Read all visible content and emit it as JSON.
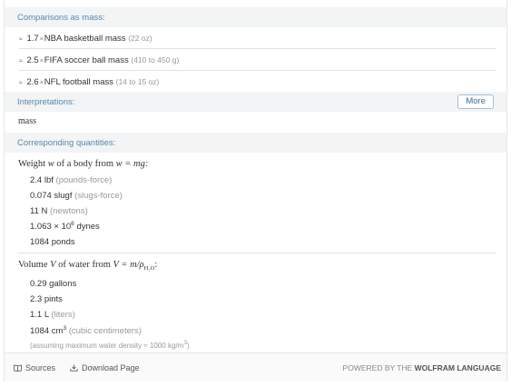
{
  "comparisons": {
    "title": "Comparisons as mass:",
    "rows": [
      {
        "approx": "≈",
        "factor": "1.7",
        "times": "×",
        "object": "NBA basketball mass",
        "range": "(22 oz)"
      },
      {
        "approx": "≈",
        "factor": "2.5",
        "times": "×",
        "object": "FIFA soccer ball mass",
        "range": "(410 to 450 g)"
      },
      {
        "approx": "≈",
        "factor": "2.6",
        "times": "×",
        "object": "NFL football mass",
        "range": "(14 to 15 oz)"
      }
    ]
  },
  "interpretations": {
    "title": "Interpretations:",
    "more_label": "More",
    "value": "mass"
  },
  "corresponding": {
    "title": "Corresponding quantities:",
    "weight": {
      "heading_prefix": "Weight",
      "heading_var": "w",
      "heading_mid": "of a body from",
      "heading_formula": "w = mg:",
      "lines": [
        {
          "value": "2.4 lbf",
          "desc": "(pounds-force)"
        },
        {
          "value": "0.074 slugf",
          "desc": "(slugs-force)"
        },
        {
          "value": "11 N",
          "desc": "(newtons)"
        },
        {
          "value": "1.063 × 10",
          "exp": "6",
          "suffix": "dynes"
        },
        {
          "value": "1084 ponds",
          "desc": ""
        }
      ]
    },
    "volume": {
      "heading_prefix": "Volume",
      "heading_var": "V",
      "heading_mid": "of water from",
      "heading_formula": "V = m/ρ",
      "heading_sub": "H₂O",
      "heading_end": ":",
      "lines": [
        {
          "value": "0.29 gallons",
          "desc": ""
        },
        {
          "value": "2.3 pints",
          "desc": ""
        },
        {
          "value": "1.1 L",
          "desc": "(liters)"
        },
        {
          "value": "1084 cm",
          "exp": "3",
          "desc": "(cubic centimeters)"
        }
      ],
      "note": "(assuming maximum water density ≈ 1000 kg/m",
      "note_exp": "3",
      "note_end": ")"
    }
  },
  "footer": {
    "sources_label": "Sources",
    "download_label": "Download Page",
    "powered_prefix": "POWERED BY THE",
    "powered_brand": "WOLFRAM LANGUAGE"
  }
}
